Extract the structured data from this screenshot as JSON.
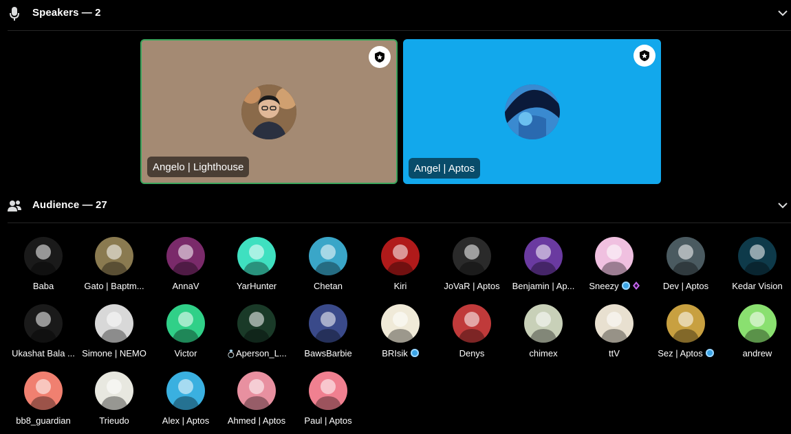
{
  "speakers": {
    "title": "Speakers — 2",
    "tiles": [
      {
        "name": "Angelo | Lighthouse",
        "bg": "#a48a73",
        "active": true
      },
      {
        "name": "Angel | Aptos",
        "bg": "#12a8ec",
        "active": false
      }
    ]
  },
  "audience": {
    "title": "Audience — 27",
    "members": [
      {
        "name": "Baba",
        "badge": "",
        "color": "#1a1a1a"
      },
      {
        "name": "Gato | Baptm...",
        "badge": "",
        "color": "#8a7a50"
      },
      {
        "name": "AnnaV",
        "badge": "",
        "color": "#7a2a6a"
      },
      {
        "name": "YarHunter",
        "badge": "",
        "color": "#3fe0c0"
      },
      {
        "name": "Chetan",
        "badge": "",
        "color": "#3aa6c8"
      },
      {
        "name": "Kiri",
        "badge": "",
        "color": "#b01a1a"
      },
      {
        "name": "JoVaR | Aptos",
        "badge": "",
        "color": "#2a2a2a"
      },
      {
        "name": "Benjamin | Ap...",
        "badge": "",
        "color": "#6a3aa0"
      },
      {
        "name": "Sneezy",
        "badge": "globe-gem",
        "color": "#f0c0e0"
      },
      {
        "name": "Dev | Aptos",
        "badge": "",
        "color": "#4a5a60"
      },
      {
        "name": "Kedar Vision",
        "badge": "",
        "color": "#0e3a4a"
      },
      {
        "name": "Ukashat Bala ...",
        "badge": "",
        "color": "#1a1a1a"
      },
      {
        "name": "Simone | NEMO",
        "badge": "",
        "color": "#d8d8d8"
      },
      {
        "name": "Victor",
        "badge": "",
        "color": "#30d088"
      },
      {
        "name": "Aperson_L...",
        "badge": "ring",
        "color": "#1a3a28"
      },
      {
        "name": "BawsBarbie",
        "badge": "",
        "color": "#3a4a8a"
      },
      {
        "name": "BRIsik",
        "badge": "globe",
        "color": "#f0ead8"
      },
      {
        "name": "Denys",
        "badge": "",
        "color": "#c03a3a"
      },
      {
        "name": "chimex",
        "badge": "",
        "color": "#c8d0b8"
      },
      {
        "name": "ttV",
        "badge": "",
        "color": "#e8e0d0"
      },
      {
        "name": "Sez | Aptos",
        "badge": "globe",
        "color": "#c8a040"
      },
      {
        "name": "andrew",
        "badge": "",
        "color": "#8ae070"
      },
      {
        "name": "bb8_guardian",
        "badge": "",
        "color": "#f08070"
      },
      {
        "name": "Trieudo",
        "badge": "",
        "color": "#e8e8e0"
      },
      {
        "name": "Alex | Aptos",
        "badge": "",
        "color": "#3ab0e0"
      },
      {
        "name": "Ahmed | Aptos",
        "badge": "",
        "color": "#e890a0"
      },
      {
        "name": "Paul | Aptos",
        "badge": "",
        "color": "#f08090"
      }
    ]
  },
  "icons": {
    "speakers": "microphone-icon",
    "audience": "people-icon",
    "collapse": "chevron-down-icon",
    "moderator": "shield-star-icon"
  },
  "colors": {
    "background": "#000000",
    "active_speaker_border": "#3ba55c",
    "divider": "#262626"
  }
}
